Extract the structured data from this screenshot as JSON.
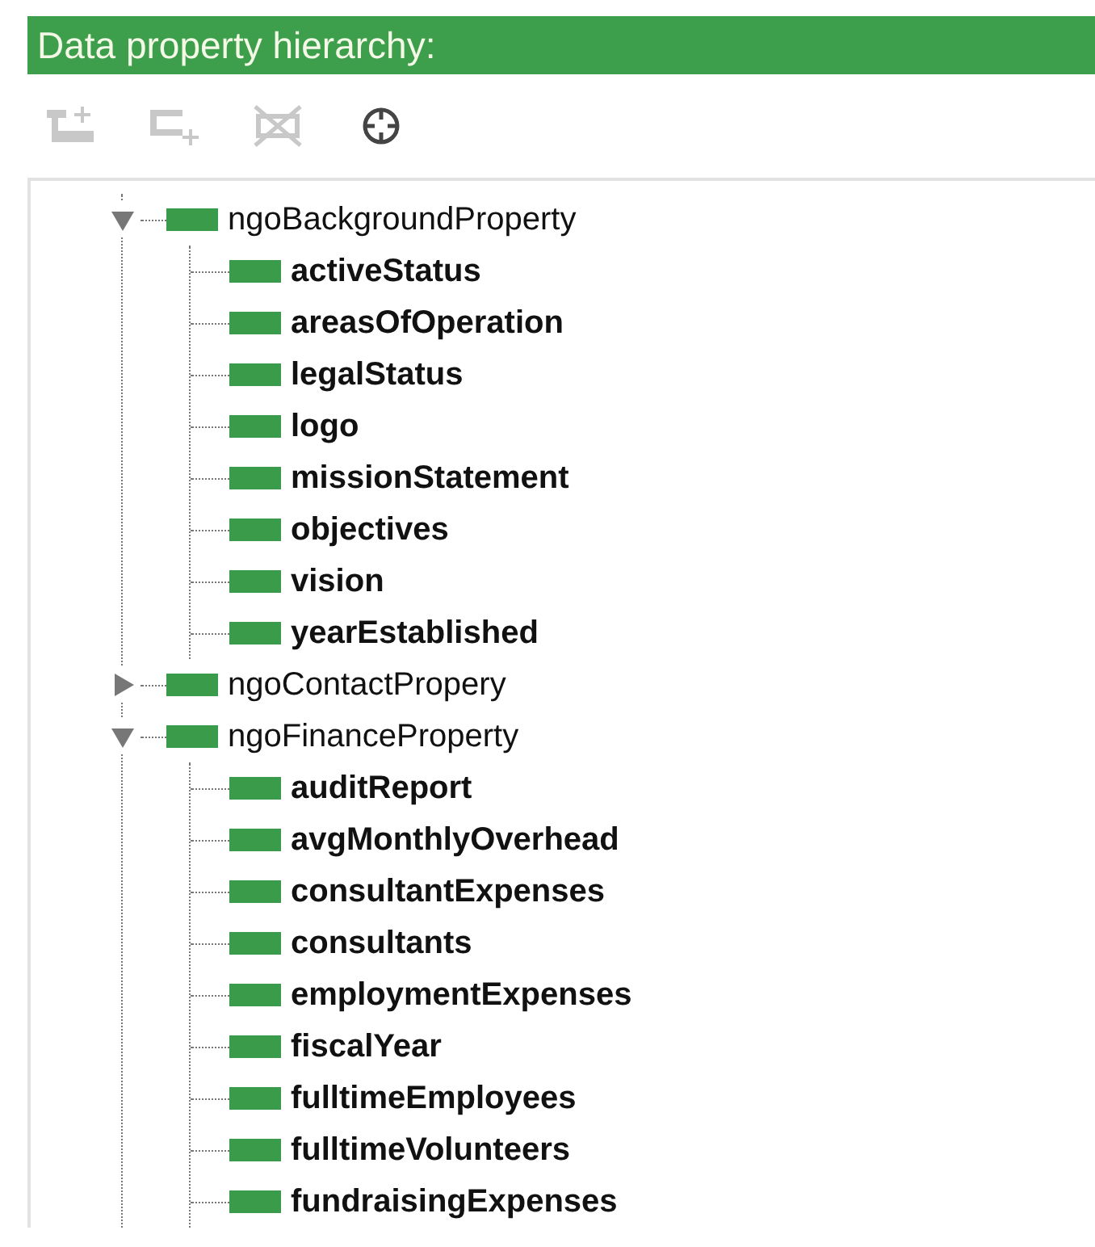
{
  "panel": {
    "title": "Data property hierarchy:"
  },
  "toolbar": [
    {
      "kind": "add-sub",
      "disabled": true
    },
    {
      "kind": "add-sibling",
      "disabled": true
    },
    {
      "kind": "delete",
      "disabled": true
    },
    {
      "kind": "find",
      "disabled": false
    }
  ],
  "tree": [
    {
      "label": "ngoBackgroundProperty",
      "expanded": true,
      "children": [
        {
          "label": "activeStatus"
        },
        {
          "label": "areasOfOperation"
        },
        {
          "label": "legalStatus"
        },
        {
          "label": "logo"
        },
        {
          "label": "missionStatement"
        },
        {
          "label": "objectives"
        },
        {
          "label": "vision"
        },
        {
          "label": "yearEstablished"
        }
      ]
    },
    {
      "label": "ngoContactPropery",
      "expanded": false
    },
    {
      "label": "ngoFinanceProperty",
      "expanded": true,
      "children": [
        {
          "label": "auditReport"
        },
        {
          "label": "avgMonthlyOverhead"
        },
        {
          "label": "consultantExpenses"
        },
        {
          "label": "consultants"
        },
        {
          "label": "employmentExpenses"
        },
        {
          "label": "fiscalYear"
        },
        {
          "label": "fulltimeEmployees"
        },
        {
          "label": "fulltimeVolunteers"
        },
        {
          "label": "fundraisingExpenses"
        }
      ]
    }
  ]
}
